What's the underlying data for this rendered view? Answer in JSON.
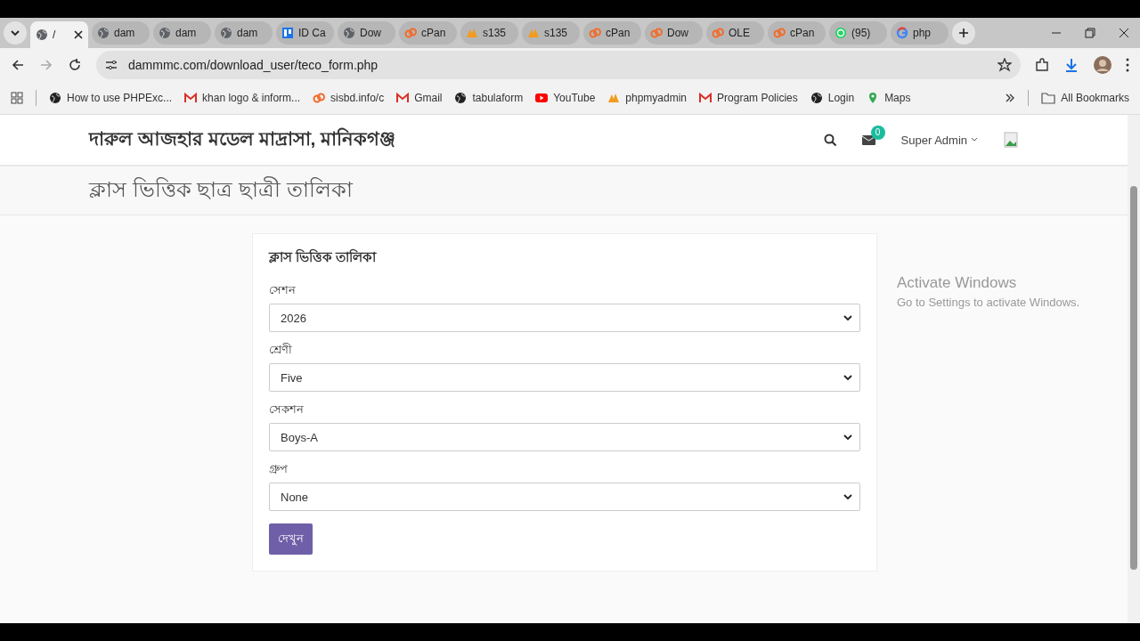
{
  "browser": {
    "tabs": [
      {
        "label": "/",
        "kind": "globe",
        "selected": true
      },
      {
        "label": "dam",
        "kind": "globe",
        "selected": false
      },
      {
        "label": "dam",
        "kind": "globe",
        "selected": false
      },
      {
        "label": "dam",
        "kind": "globe",
        "selected": false
      },
      {
        "label": "ID Ca",
        "kind": "card",
        "selected": false
      },
      {
        "label": "Dow",
        "kind": "globe",
        "selected": false
      },
      {
        "label": "cPan",
        "kind": "cpanel",
        "selected": false
      },
      {
        "label": "s135",
        "kind": "pma",
        "selected": false
      },
      {
        "label": "s135",
        "kind": "pma",
        "selected": false
      },
      {
        "label": "cPan",
        "kind": "cpanel",
        "selected": false
      },
      {
        "label": "Dow",
        "kind": "cpanel",
        "selected": false
      },
      {
        "label": "OLE",
        "kind": "cpanel",
        "selected": false
      },
      {
        "label": "cPan",
        "kind": "cpanel",
        "selected": false
      },
      {
        "label": "(95)",
        "kind": "whatsapp",
        "selected": false
      },
      {
        "label": "php",
        "kind": "google",
        "selected": false
      }
    ],
    "address": "dammmc.com/download_user/teco_form.php",
    "bookmarks": [
      {
        "label": "How to use PHPExc...",
        "kind": "globe"
      },
      {
        "label": "khan logo & inform...",
        "kind": "gmail"
      },
      {
        "label": "sisbd.info/c",
        "kind": "cpanel"
      },
      {
        "label": "Gmail",
        "kind": "gmail"
      },
      {
        "label": "tabulaform",
        "kind": "globe"
      },
      {
        "label": "YouTube",
        "kind": "youtube"
      },
      {
        "label": "phpmyadmin",
        "kind": "pma"
      },
      {
        "label": "Program Policies",
        "kind": "gmail"
      },
      {
        "label": "Login",
        "kind": "globe"
      },
      {
        "label": "Maps",
        "kind": "maps"
      }
    ],
    "all_bookmarks": "All Bookmarks"
  },
  "header": {
    "site_name": "দারুল আজহার মডেল মাদ্রাসা, মানিকগঞ্জ",
    "messages_count": "0",
    "user": "Super Admin"
  },
  "page_title": "ক্লাস ভিত্তিক ছাত্র ছাত্রী তালিকা",
  "form": {
    "title": "ক্লাস ভিত্তিক তালিকা",
    "fields": [
      {
        "label": "সেশন",
        "value": "2026"
      },
      {
        "label": "শ্রেণী",
        "value": "Five"
      },
      {
        "label": "সেকশন",
        "value": "Boys-A"
      },
      {
        "label": "গ্রুপ",
        "value": "None"
      }
    ],
    "submit": "দেখুন"
  },
  "os_notice": {
    "title": "Activate Windows",
    "text": "Go to Settings to activate Windows."
  }
}
